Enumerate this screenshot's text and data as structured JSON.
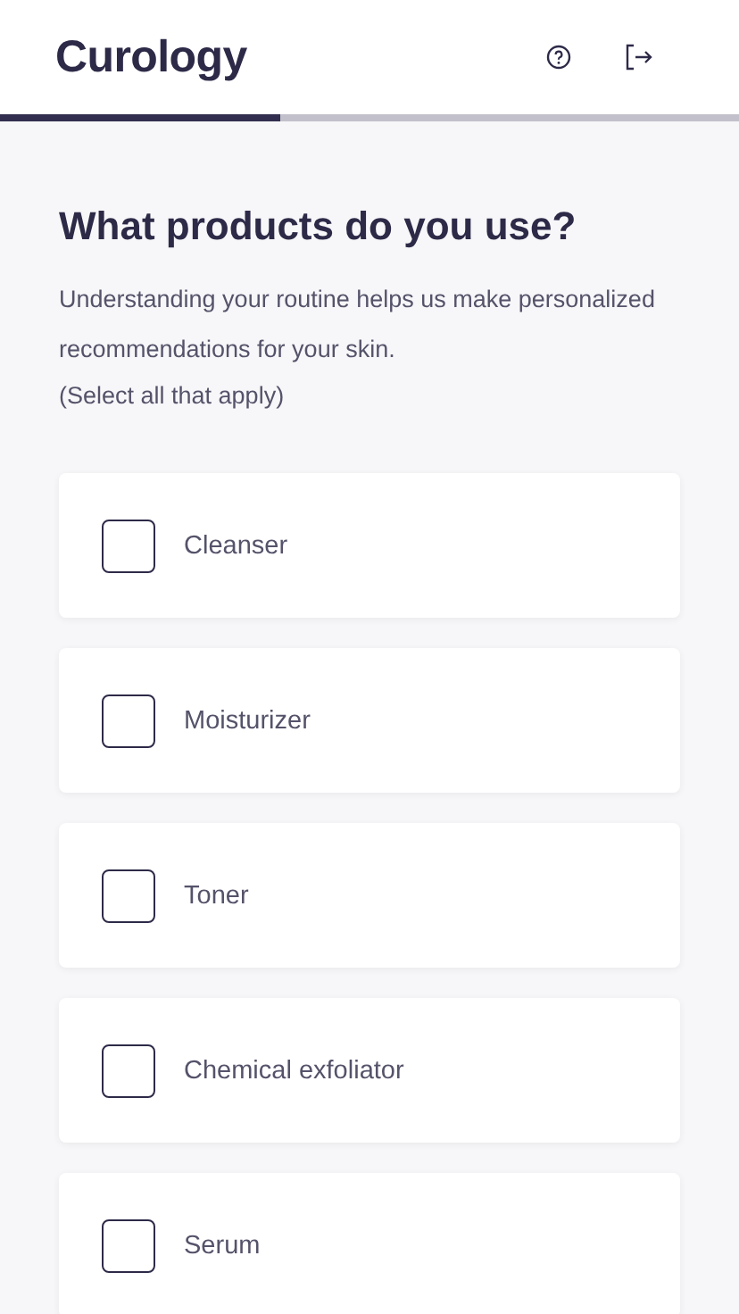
{
  "header": {
    "logo": "Curology"
  },
  "progress": {
    "level": 0.38
  },
  "question": {
    "title": "What products do you use?",
    "description": "Understanding your routine helps us make personalized recommendations for your skin.",
    "hint": "(Select all that apply)"
  },
  "options": [
    {
      "label": "Cleanser",
      "checked": false
    },
    {
      "label": "Moisturizer",
      "checked": false
    },
    {
      "label": "Toner",
      "checked": false
    },
    {
      "label": "Chemical exfoliator",
      "checked": false
    },
    {
      "label": "Serum",
      "checked": false
    }
  ]
}
